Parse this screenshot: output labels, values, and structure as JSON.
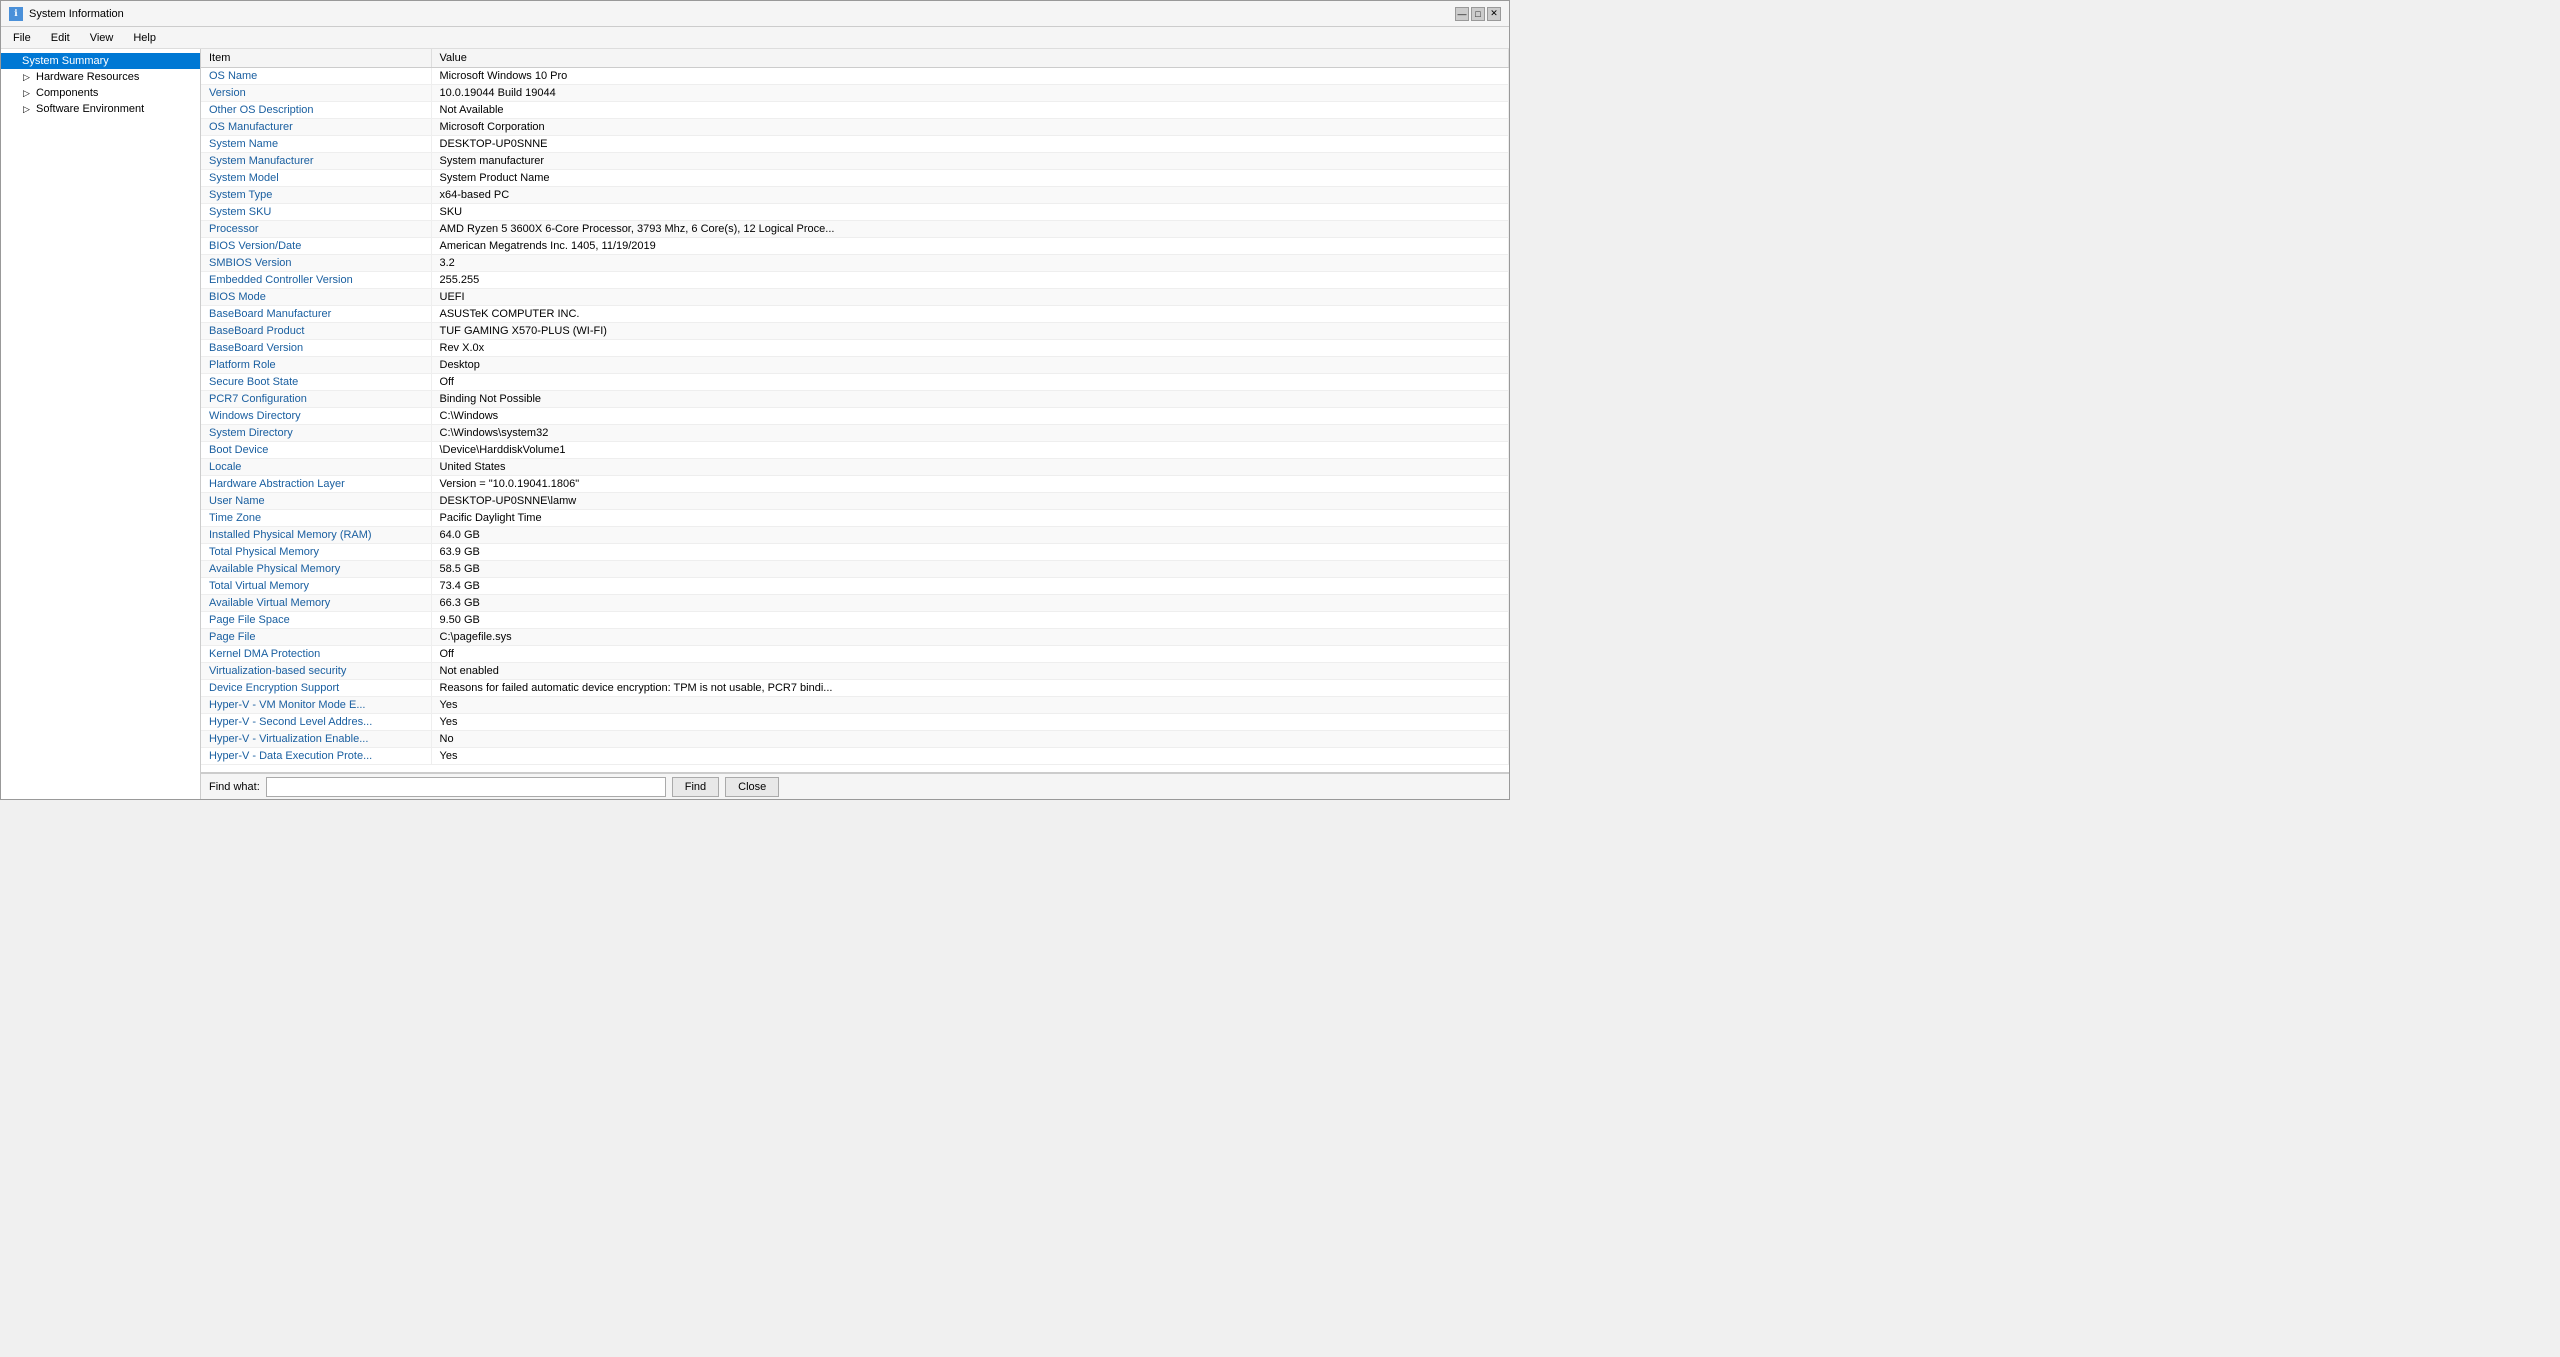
{
  "window": {
    "title": "System Information",
    "icon": "ℹ"
  },
  "titlebar": {
    "controls": [
      "—",
      "□",
      "✕"
    ]
  },
  "menu": {
    "items": [
      "File",
      "Edit",
      "View",
      "Help"
    ]
  },
  "sidebar": {
    "items": [
      {
        "id": "system-summary",
        "label": "System Summary",
        "selected": true,
        "indent": 0,
        "expander": ""
      },
      {
        "id": "hardware-resources",
        "label": "Hardware Resources",
        "selected": false,
        "indent": 1,
        "expander": "▷"
      },
      {
        "id": "components",
        "label": "Components",
        "selected": false,
        "indent": 1,
        "expander": "▷"
      },
      {
        "id": "software-environment",
        "label": "Software Environment",
        "selected": false,
        "indent": 1,
        "expander": "▷"
      }
    ]
  },
  "table": {
    "headers": [
      "Item",
      "Value"
    ],
    "rows": [
      {
        "item": "OS Name",
        "value": "Microsoft Windows 10 Pro"
      },
      {
        "item": "Version",
        "value": "10.0.19044 Build 19044"
      },
      {
        "item": "Other OS Description",
        "value": "Not Available"
      },
      {
        "item": "OS Manufacturer",
        "value": "Microsoft Corporation"
      },
      {
        "item": "System Name",
        "value": "DESKTOP-UP0SNNE"
      },
      {
        "item": "System Manufacturer",
        "value": "System manufacturer"
      },
      {
        "item": "System Model",
        "value": "System Product Name"
      },
      {
        "item": "System Type",
        "value": "x64-based PC"
      },
      {
        "item": "System SKU",
        "value": "SKU"
      },
      {
        "item": "Processor",
        "value": "AMD Ryzen 5 3600X 6-Core Processor, 3793 Mhz, 6 Core(s), 12 Logical Proce..."
      },
      {
        "item": "BIOS Version/Date",
        "value": "American Megatrends Inc. 1405, 11/19/2019"
      },
      {
        "item": "SMBIOS Version",
        "value": "3.2"
      },
      {
        "item": "Embedded Controller Version",
        "value": "255.255"
      },
      {
        "item": "BIOS Mode",
        "value": "UEFI"
      },
      {
        "item": "BaseBoard Manufacturer",
        "value": "ASUSTeK COMPUTER INC."
      },
      {
        "item": "BaseBoard Product",
        "value": "TUF GAMING X570-PLUS (WI-FI)"
      },
      {
        "item": "BaseBoard Version",
        "value": "Rev X.0x"
      },
      {
        "item": "Platform Role",
        "value": "Desktop"
      },
      {
        "item": "Secure Boot State",
        "value": "Off"
      },
      {
        "item": "PCR7 Configuration",
        "value": "Binding Not Possible"
      },
      {
        "item": "Windows Directory",
        "value": "C:\\Windows"
      },
      {
        "item": "System Directory",
        "value": "C:\\Windows\\system32"
      },
      {
        "item": "Boot Device",
        "value": "\\Device\\HarddiskVolume1"
      },
      {
        "item": "Locale",
        "value": "United States"
      },
      {
        "item": "Hardware Abstraction Layer",
        "value": "Version = \"10.0.19041.1806\""
      },
      {
        "item": "User Name",
        "value": "DESKTOP-UP0SNNE\\lamw"
      },
      {
        "item": "Time Zone",
        "value": "Pacific Daylight Time"
      },
      {
        "item": "Installed Physical Memory (RAM)",
        "value": "64.0 GB"
      },
      {
        "item": "Total Physical Memory",
        "value": "63.9 GB"
      },
      {
        "item": "Available Physical Memory",
        "value": "58.5 GB"
      },
      {
        "item": "Total Virtual Memory",
        "value": "73.4 GB"
      },
      {
        "item": "Available Virtual Memory",
        "value": "66.3 GB"
      },
      {
        "item": "Page File Space",
        "value": "9.50 GB"
      },
      {
        "item": "Page File",
        "value": "C:\\pagefile.sys"
      },
      {
        "item": "Kernel DMA Protection",
        "value": "Off"
      },
      {
        "item": "Virtualization-based security",
        "value": "Not enabled"
      },
      {
        "item": "Device Encryption Support",
        "value": "Reasons for failed automatic device encryption: TPM is not usable, PCR7 bindi..."
      },
      {
        "item": "Hyper-V - VM Monitor Mode E...",
        "value": "Yes"
      },
      {
        "item": "Hyper-V - Second Level Addres...",
        "value": "Yes"
      },
      {
        "item": "Hyper-V - Virtualization Enable...",
        "value": "No"
      },
      {
        "item": "Hyper-V - Data Execution Prote...",
        "value": "Yes"
      }
    ]
  },
  "findbar": {
    "label": "Find what:",
    "placeholder": "",
    "find_button": "Find",
    "close_button": "Close"
  }
}
